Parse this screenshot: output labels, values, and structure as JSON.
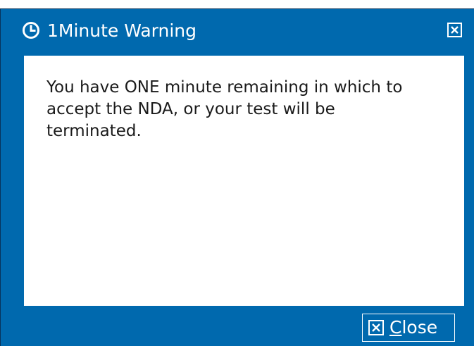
{
  "dialog": {
    "title": "1Minute Warning",
    "title_icon": "clock-icon",
    "close_icon": "close-box-icon",
    "message": "You have ONE minute remaining in which to accept the NDA, or your test will be terminated."
  },
  "footer": {
    "close_button": {
      "accel": "C",
      "rest": "lose",
      "icon": "close-box-icon"
    }
  },
  "colors": {
    "frame": "#0069ae",
    "content": "#ffffff",
    "text": "#1a1a1a",
    "title_text": "#ffffff"
  }
}
